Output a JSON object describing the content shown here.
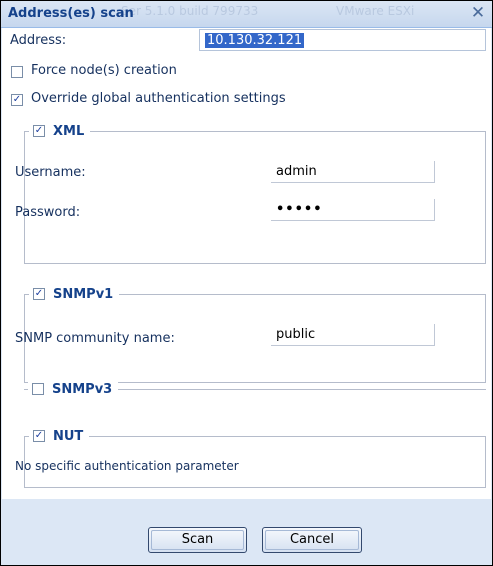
{
  "dialog": {
    "title": "Address(es) scan",
    "close_glyph": "✕",
    "ghost_text_left": "Ser 5.1.0 build 799733",
    "ghost_text_right": "VMware ESXi"
  },
  "form": {
    "address_label": "Address:",
    "address_value": "10.130.32.121",
    "force_creation": {
      "label": "Force node(s) creation",
      "checked": false
    },
    "override_auth": {
      "label": "Override global authentication settings",
      "checked": true
    }
  },
  "sections": {
    "xml": {
      "title": "XML",
      "checked": true,
      "username_label": "Username:",
      "username_value": "admin",
      "password_label": "Password:",
      "password_value": "•••••"
    },
    "snmpv1": {
      "title": "SNMPv1",
      "checked": true,
      "community_label": "SNMP community name:",
      "community_value": "public"
    },
    "snmpv3": {
      "title": "SNMPv3",
      "checked": false
    },
    "nut": {
      "title": "NUT",
      "checked": true,
      "note": "No specific authentication parameter"
    }
  },
  "buttons": {
    "scan": "Scan",
    "cancel": "Cancel"
  },
  "colors": {
    "title_text": "#15428b",
    "selection": "#3367c9",
    "footer_bg": "#dce7f5"
  }
}
